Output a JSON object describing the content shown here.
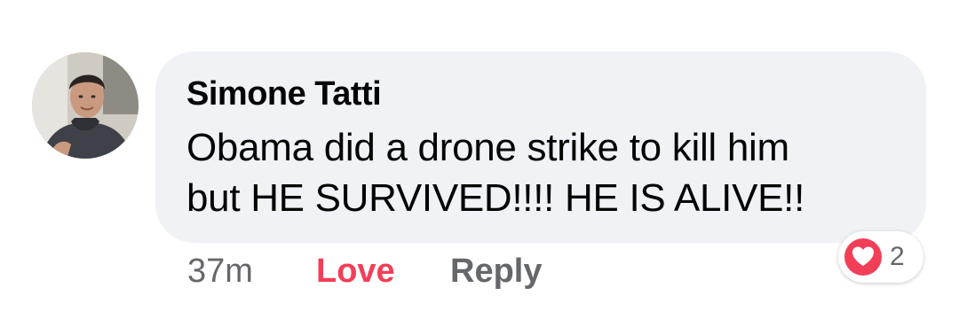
{
  "comment": {
    "author": "Simone Tatti",
    "text_lines": [
      "Obama did a drone strike to kill him",
      "but HE SURVIVED!!!! HE IS ALIVE!!"
    ],
    "timestamp": "37m",
    "love_label": "Love",
    "reply_label": "Reply",
    "reactions": {
      "icon": "heart-icon",
      "count": "2",
      "color": "#f33e58"
    }
  },
  "colors": {
    "bubble": "#f0f2f5",
    "text": "#050505",
    "secondary": "#65676b",
    "love_accent": "#f33e58"
  }
}
